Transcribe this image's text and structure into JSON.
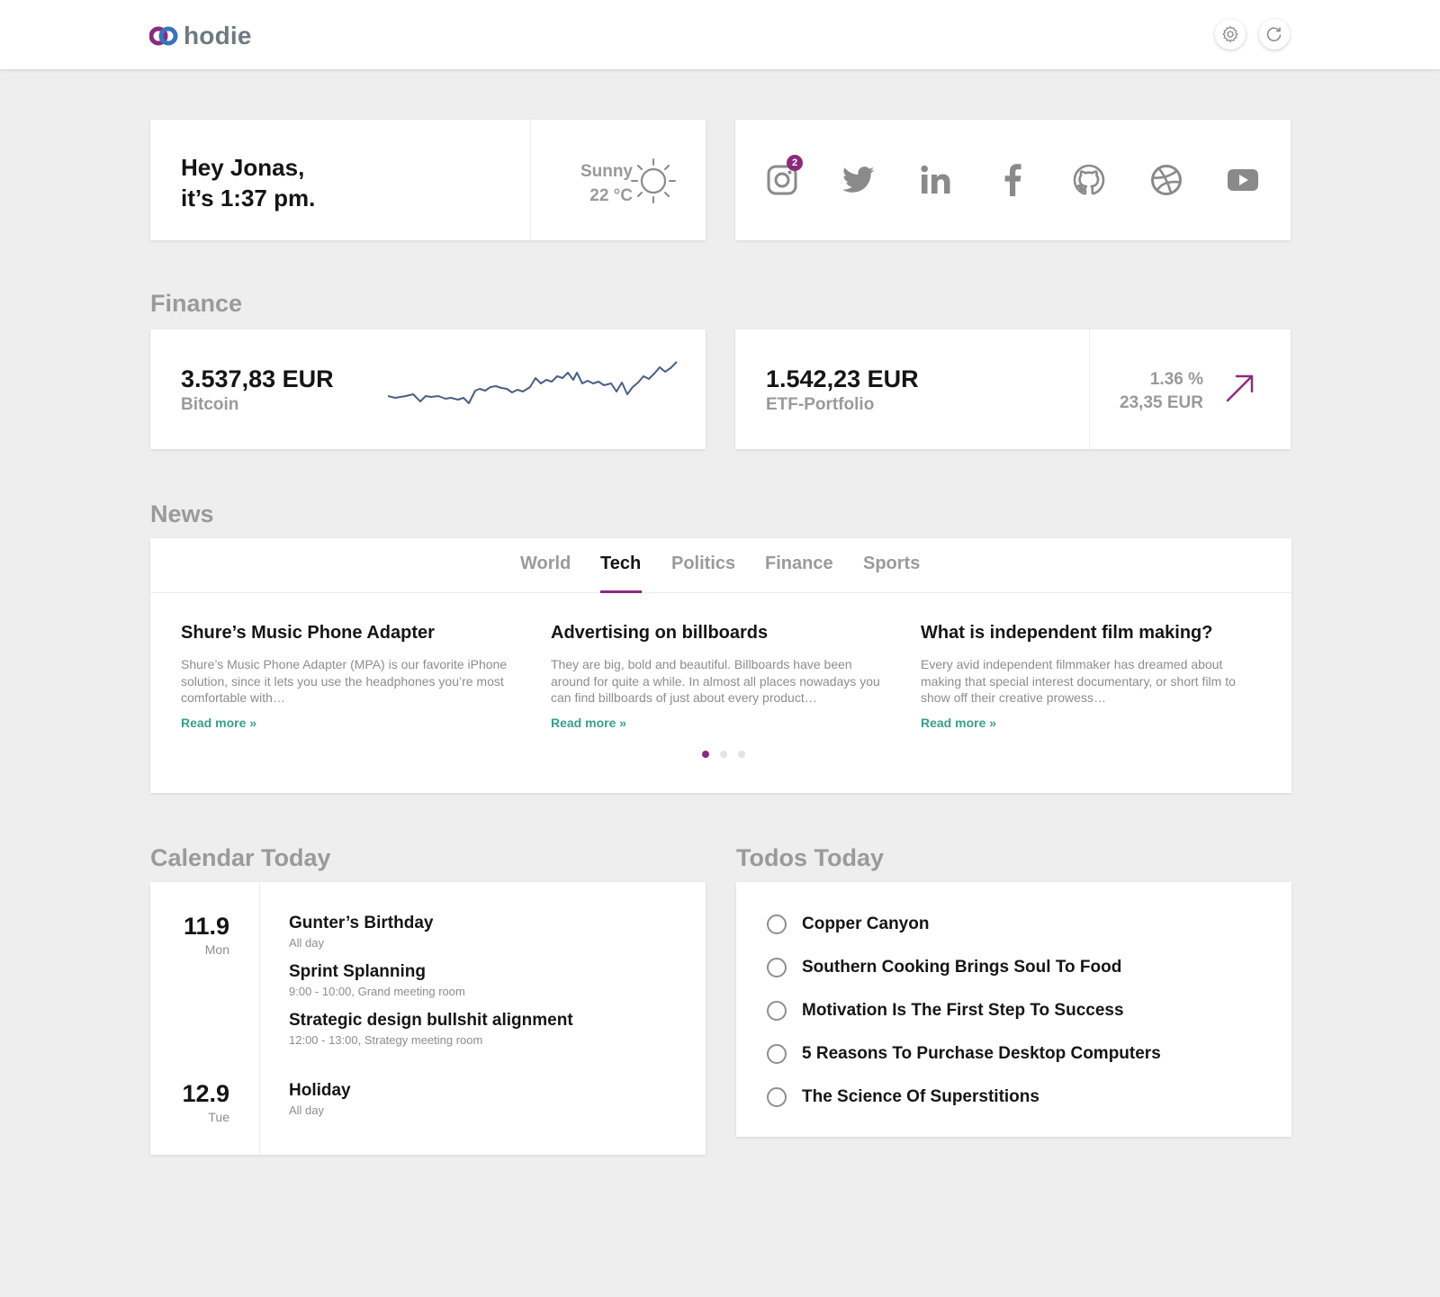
{
  "app": {
    "logo_text": "hodie"
  },
  "toolbar": {
    "settings_icon": "gear-icon",
    "refresh_icon": "refresh-icon"
  },
  "greeting": {
    "line1": "Hey Jonas,",
    "line2": "it’s 1:37 pm."
  },
  "weather": {
    "condition": "Sunny",
    "temperature": "22 °C",
    "icon": "sun-icon"
  },
  "social": {
    "items": [
      {
        "name": "instagram",
        "icon": "instagram-icon",
        "badge": "2"
      },
      {
        "name": "twitter",
        "icon": "twitter-icon"
      },
      {
        "name": "linkedin",
        "icon": "linkedin-icon"
      },
      {
        "name": "facebook",
        "icon": "facebook-icon"
      },
      {
        "name": "github",
        "icon": "github-icon"
      },
      {
        "name": "dribbble",
        "icon": "dribbble-icon"
      },
      {
        "name": "youtube",
        "icon": "youtube-icon"
      }
    ]
  },
  "finance": {
    "title": "Finance",
    "bitcoin": {
      "value": "3.537,83 EUR",
      "label": "Bitcoin"
    },
    "etf": {
      "value": "1.542,23 EUR",
      "label": "ETF-Portfolio",
      "change_pct": "1.36 %",
      "change_abs": "23,35 EUR"
    }
  },
  "news": {
    "title": "News",
    "tabs": [
      {
        "label": "World"
      },
      {
        "label": "Tech"
      },
      {
        "label": "Politics"
      },
      {
        "label": "Finance"
      },
      {
        "label": "Sports"
      }
    ],
    "active_tab": "Tech",
    "articles": [
      {
        "title": "Shure’s Music Phone Adapter",
        "text": "Shure’s Music Phone Adapter (MPA) is our favorite iPhone solution, since it lets you use the headphones you’re most comfortable with…",
        "link": "Read more »"
      },
      {
        "title": "Advertising on billboards",
        "text": "They are big, bold and beautiful. Billboards have been around for quite a while. In almost all places nowadays you can find billboards of just about every product…",
        "link": "Read more »"
      },
      {
        "title": "What is independent film making?",
        "text": "Every avid independent filmmaker has dreamed about making that special interest documentary, or short film to show off their creative prowess…",
        "link": "Read more »"
      }
    ],
    "pagination": {
      "total": 3,
      "current": 1
    }
  },
  "calendar": {
    "title": "Calendar Today",
    "days": [
      {
        "date": "11.9",
        "weekday": "Mon",
        "events": [
          {
            "title": "Gunter’s Birthday",
            "detail": "All day"
          },
          {
            "title": "Sprint Splanning",
            "detail": "9:00 - 10:00, Grand meeting room"
          },
          {
            "title": "Strategic design bullshit alignment",
            "detail": "12:00 - 13:00, Strategy meeting room"
          }
        ]
      },
      {
        "date": "12.9",
        "weekday": "Tue",
        "events": [
          {
            "title": "Holiday",
            "detail": "All day"
          }
        ]
      }
    ]
  },
  "todos": {
    "title": "Todos Today",
    "items": [
      {
        "label": "Copper Canyon",
        "done": false
      },
      {
        "label": "Southern Cooking Brings Soul To Food",
        "done": false
      },
      {
        "label": "Motivation Is The First Step To Success",
        "done": false
      },
      {
        "label": "5 Reasons To Purchase Desktop Computers",
        "done": false
      },
      {
        "label": "The Science Of Superstitions",
        "done": false
      }
    ]
  },
  "colors": {
    "accent": "#8b2a7d",
    "link": "#3a9d8e",
    "sparkline": "#4a5f82",
    "background": "#eeeeef"
  }
}
